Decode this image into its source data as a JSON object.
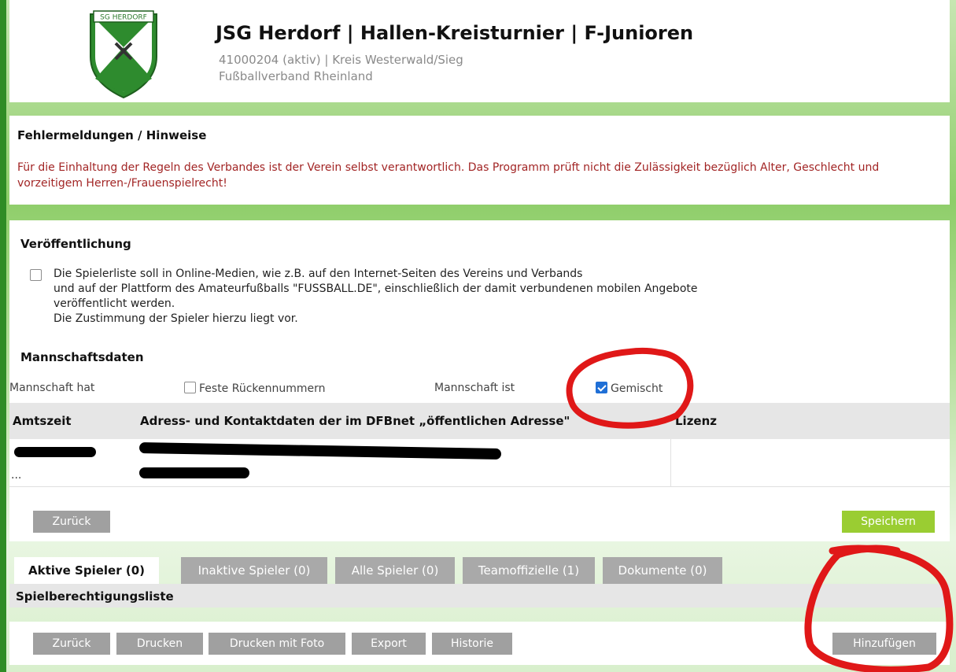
{
  "header": {
    "logo_text": "SG HERDORF",
    "title": "JSG Herdorf | Hallen-Kreisturnier | F-Junioren",
    "subtitle_line1": "41000204 (aktiv) | Kreis Westerwald/Sieg",
    "subtitle_line2": "Fußballverband Rheinland"
  },
  "errors": {
    "heading": "Fehlermeldungen / Hinweise",
    "text": "Für die Einhaltung der Regeln des Verbandes ist der Verein selbst verantwortlich. Das Programm prüft nicht die Zulässigkeit bezüglich Alter, Geschlecht und vorzeitigem Herren-/Frauenspielrecht!"
  },
  "publication": {
    "heading": "Veröffentlichung",
    "checked": false,
    "line1": "Die Spielerliste soll in Online-Medien, wie z.B. auf den Internet-Seiten des Vereins und Verbands",
    "line2": "und auf der Plattform des Amateurfußballs \"FUSSBALL.DE\", einschließlich der damit verbundenen mobilen Angebote",
    "line3": "veröffentlicht werden.",
    "line4": "Die Zustimmung der Spieler hierzu liegt vor."
  },
  "team": {
    "heading": "Mannschaftsdaten",
    "has_label": "Mannschaft hat",
    "fixed_numbers_label": "Feste Rückennummern",
    "fixed_numbers_checked": false,
    "is_label": "Mannschaft ist",
    "mixed_label": "Gemischt",
    "mixed_checked": true
  },
  "table": {
    "columns": [
      "Amtszeit",
      "Adress- und Kontaktdaten der im DFBnet „öffentlichen Adresse\"",
      "Lizenz"
    ],
    "row_ellipsis": "..."
  },
  "buttons": {
    "back": "Zurück",
    "save": "Speichern",
    "print": "Drucken",
    "print_photo": "Drucken mit Foto",
    "export": "Export",
    "history": "Historie",
    "add": "Hinzufügen"
  },
  "tabs": [
    {
      "label": "Aktive Spieler (0)",
      "active": true
    },
    {
      "label": "Inaktive Spieler (0)",
      "active": false
    },
    {
      "label": "Alle Spieler (0)",
      "active": false
    },
    {
      "label": "Teamoffizielle (1)",
      "active": false
    },
    {
      "label": "Dokumente (0)",
      "active": false
    }
  ],
  "list_heading": "Spielberechtigungsliste",
  "colors": {
    "accent_green": "#9acd32",
    "sidebar_green": "#2f8c25",
    "error_red": "#a22525",
    "button_gray": "#a0a0a0",
    "annotation_red": "#e01818"
  }
}
